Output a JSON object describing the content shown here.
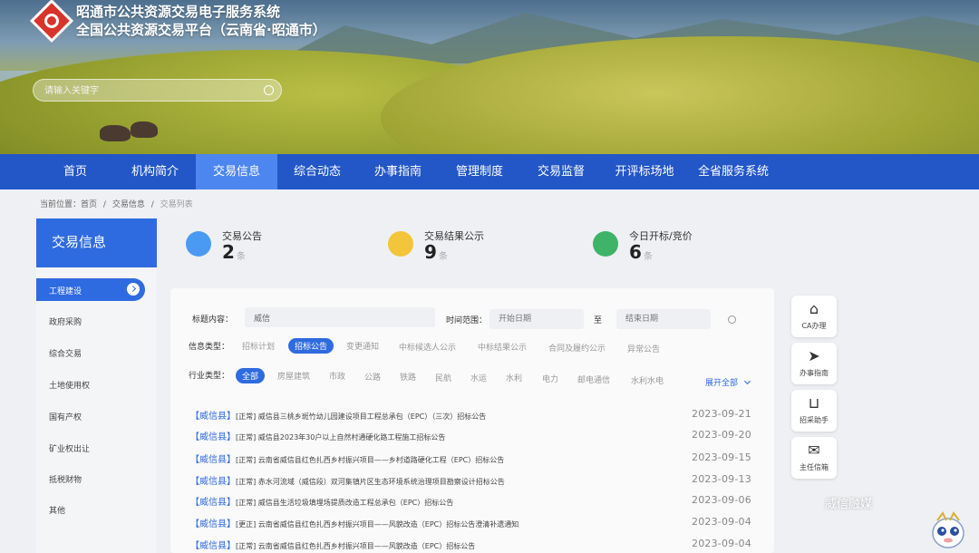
{
  "header": {
    "title_line1": "昭通市公共资源交易电子服务系统",
    "title_line2": "全国公共资源交易平台（云南省·昭通市）",
    "search_placeholder": "请输入关键字"
  },
  "nav": [
    "首页",
    "机构简介",
    "交易信息",
    "综合动态",
    "办事指南",
    "管理制度",
    "交易监督",
    "开评标场地",
    "全省服务系统"
  ],
  "breadcrumb": {
    "prefix": "当前位置：首页",
    "sep": "/",
    "level2": "交易信息",
    "level3": "交易列表"
  },
  "sidebar": {
    "title": "交易信息",
    "items": [
      "工程建设",
      "政府采购",
      "综合交易",
      "土地使用权",
      "国有产权",
      "矿业权出让",
      "抵税财物",
      "其他"
    ]
  },
  "stats": [
    {
      "label": "交易公告",
      "count": "2",
      "unit": "条",
      "color": "#4a9af4"
    },
    {
      "label": "交易结果公示",
      "count": "9",
      "unit": "条",
      "color": "#f2c53a"
    },
    {
      "label": "今日开标/竞价",
      "count": "6",
      "unit": "条",
      "color": "#3fb368"
    }
  ],
  "filters": {
    "title_label": "标题内容：",
    "title_value": "威信",
    "time_label": "时间范围：",
    "time_start_placeholder": "开始日期",
    "time_to": "至",
    "time_end_placeholder": "结束日期",
    "type_label": "信息类型：",
    "types": [
      "招标计划",
      "招标公告",
      "变更通知",
      "中标候选人公示",
      "中标结果公示",
      "合同及履约公示",
      "异常公告"
    ],
    "industry_label": "行业类型：",
    "industries": [
      "全部",
      "房屋建筑",
      "市政",
      "公路",
      "铁路",
      "民航",
      "水运",
      "水利",
      "电力",
      "邮电通信",
      "水利水电"
    ],
    "expand_label": "展开全部"
  },
  "list": [
    {
      "county": "【威信县】",
      "kind": "[正常]",
      "title": "威信县三桃乡斑竹幼儿园建设项目工程总承包（EPC）（三次）招标公告",
      "date": "2023-09-21"
    },
    {
      "county": "【威信县】",
      "kind": "[正常]",
      "title": "威信县2023年30户以上自然村通硬化路工程施工招标公告",
      "date": "2023-09-20"
    },
    {
      "county": "【威信县】",
      "kind": "[正常]",
      "title": "云南省威信县红色扎西乡村振兴项目——乡村道路硬化工程（EPC）招标公告",
      "date": "2023-09-15"
    },
    {
      "county": "【威信县】",
      "kind": "[正常]",
      "title": "赤水河流域（威信段）双河集镇片区生态环境系统治理项目勘察设计招标公告",
      "date": "2023-09-13"
    },
    {
      "county": "【威信县】",
      "kind": "[正常]",
      "title": "威信县生活垃圾填埋场提质改造工程总承包（EPC）招标公告",
      "date": "2023-09-06"
    },
    {
      "county": "【威信县】",
      "kind": "[更正]",
      "title": "云南省威信县红色扎西乡村振兴项目——风貌改造（EPC）招标公告澄清补遗通知",
      "date": "2023-09-04"
    },
    {
      "county": "【威信县】",
      "kind": "[正常]",
      "title": "云南省威信县红色扎西乡村振兴项目——风貌改造（EPC）招标公告",
      "date": "2023-09-04"
    }
  ],
  "tools": [
    {
      "label": "CA办理",
      "icon": "usb-key-icon"
    },
    {
      "label": "办事指南",
      "icon": "paper-plane-icon"
    },
    {
      "label": "招采助手",
      "icon": "basket-icon"
    },
    {
      "label": "主任信箱",
      "icon": "mail-icon"
    }
  ],
  "watermark": "威信融媒"
}
